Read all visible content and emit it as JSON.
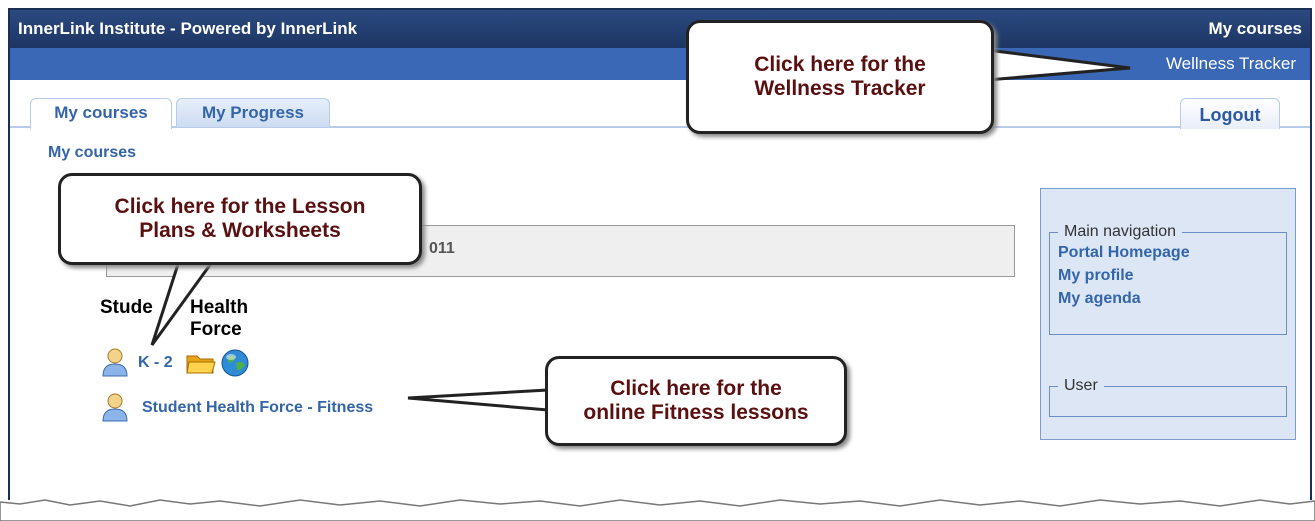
{
  "header": {
    "title": "InnerLink Institute - Powered by InnerLink",
    "my_courses": "My courses"
  },
  "subbar": {
    "wellness": "Wellness Tracker"
  },
  "tabs": [
    {
      "label": "My courses"
    },
    {
      "label": "My Progress"
    }
  ],
  "logout": "Logout",
  "breadcrumb": "My courses",
  "course_box_text": "011",
  "section": {
    "heading_a": "Stude",
    "heading_b": "Health Force"
  },
  "courses": [
    {
      "label": "K - 2"
    },
    {
      "label": "Student Health Force - Fitness"
    }
  ],
  "nav": {
    "main_legend": "Main navigation",
    "links": [
      "Portal Homepage",
      "My profile",
      "My agenda"
    ],
    "user_legend": "User"
  },
  "callouts": {
    "wellness": [
      "Click here for the",
      "Wellness Tracker"
    ],
    "lessons": [
      "Click here for the Lesson",
      "Plans & Worksheets"
    ],
    "fitness": [
      "Click here for the",
      "online Fitness lessons"
    ]
  },
  "colors": {
    "topbar": "#1d3563",
    "subbar": "#3a68b6",
    "link": "#3465a8",
    "callout_text": "#5a1010"
  }
}
